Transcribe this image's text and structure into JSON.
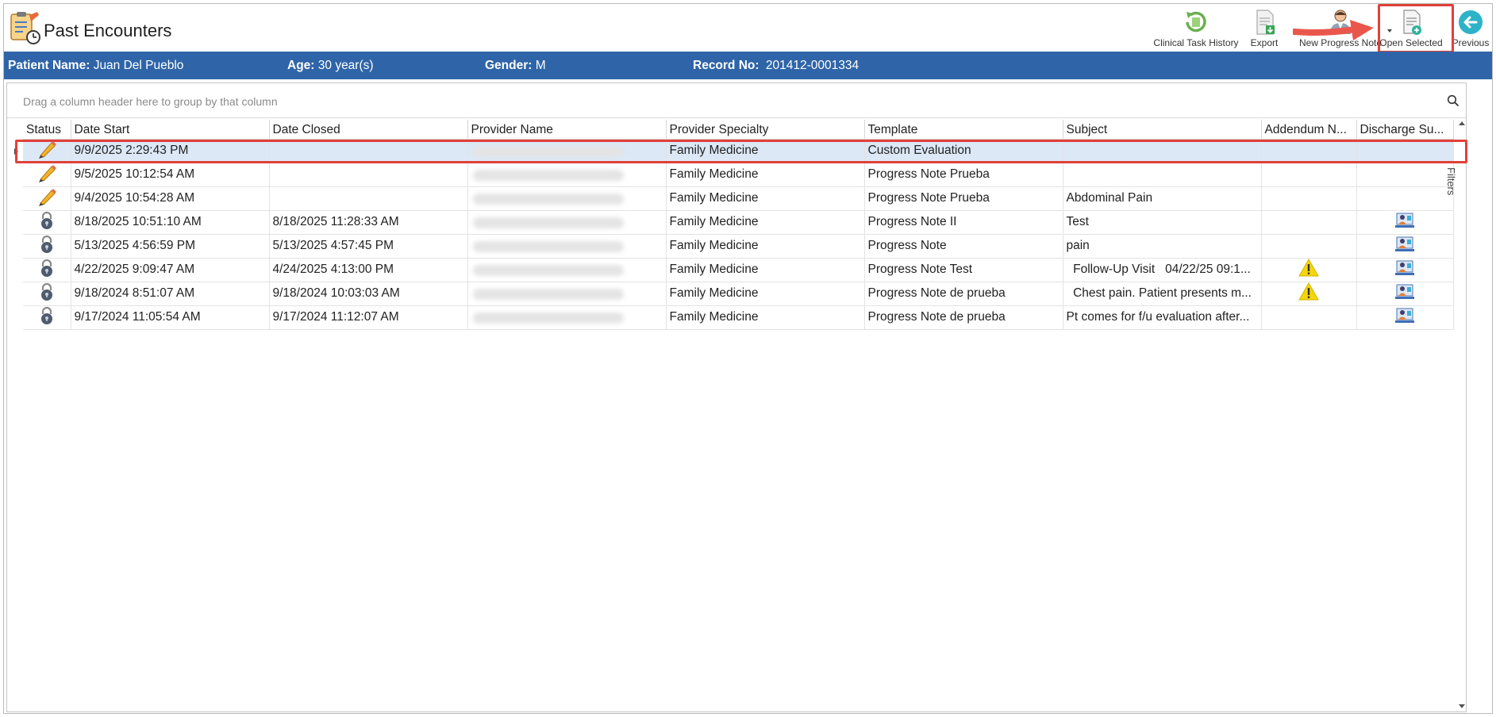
{
  "window": {
    "title": "Past Encounters"
  },
  "toolbar": {
    "clinical_task_history": "Clinical Task History",
    "export": "Export",
    "new_progress_note": "New Progress Note",
    "open_selected": "Open Selected",
    "previous": "Previous"
  },
  "patient": {
    "name_label": "Patient Name:",
    "name_value": "Juan Del Pueblo",
    "age_label": "Age:",
    "age_value": "30 year(s)",
    "gender_label": "Gender:",
    "gender_value": "M",
    "record_label": "Record No:",
    "record_value": "201412-0001334"
  },
  "grid": {
    "group_hint": "Drag a column header here to group by that column",
    "filters_label": "Filters",
    "columns": [
      "Status",
      "Date Start",
      "Date Closed",
      "Provider Name",
      "Provider Specialty",
      "Template",
      "Subject",
      "Addendum N...",
      "Discharge Su..."
    ],
    "rows": [
      {
        "status": "pencil-icon",
        "date_start": "9/9/2025 2:29:43 PM",
        "date_closed": "",
        "specialty": "Family Medicine",
        "template": "Custom Evaluation",
        "subject": "",
        "addendum": false,
        "discharge": false
      },
      {
        "status": "pencil-icon",
        "date_start": "9/5/2025 10:12:54 AM",
        "date_closed": "",
        "specialty": "Family Medicine",
        "template": "Progress Note Prueba",
        "subject": "",
        "addendum": false,
        "discharge": false
      },
      {
        "status": "pencil-icon",
        "date_start": "9/4/2025 10:54:28 AM",
        "date_closed": "",
        "specialty": "Family Medicine",
        "template": "Progress Note Prueba",
        "subject": "Abdominal Pain",
        "addendum": false,
        "discharge": false
      },
      {
        "status": "lock-icon",
        "date_start": "8/18/2025 10:51:10 AM",
        "date_closed": "8/18/2025 11:28:33 AM",
        "specialty": "Family Medicine",
        "template": "Progress Note II",
        "subject": "Test",
        "addendum": false,
        "discharge": true
      },
      {
        "status": "lock-icon",
        "date_start": "5/13/2025 4:56:59 PM",
        "date_closed": "5/13/2025 4:57:45 PM",
        "specialty": "Family Medicine",
        "template": "Progress Note",
        "subject": "pain",
        "addendum": false,
        "discharge": true
      },
      {
        "status": "lock-icon",
        "date_start": "4/22/2025 9:09:47 AM",
        "date_closed": "4/24/2025 4:13:00 PM",
        "specialty": "Family Medicine",
        "template": "Progress Note Test",
        "subject": "  Follow-Up Visit   04/22/25 09:1...",
        "addendum": true,
        "discharge": true
      },
      {
        "status": "lock-icon",
        "date_start": "9/18/2024 8:51:07 AM",
        "date_closed": "9/18/2024 10:03:03 AM",
        "specialty": "Family Medicine",
        "template": "Progress Note de prueba",
        "subject": "  Chest pain. Patient presents m...",
        "addendum": true,
        "discharge": true
      },
      {
        "status": "lock-icon",
        "date_start": "9/17/2024 11:05:54 AM",
        "date_closed": "9/17/2024 11:12:07 AM",
        "specialty": "Family Medicine",
        "template": "Progress Note de prueba",
        "subject": "Pt comes for f/u evaluation after...",
        "addendum": false,
        "discharge": true
      }
    ]
  },
  "colors": {
    "patient_bar": "#2f65a8",
    "selection": "#dce8f6",
    "highlight": "#e0413a",
    "arrow": "#e9574c"
  }
}
